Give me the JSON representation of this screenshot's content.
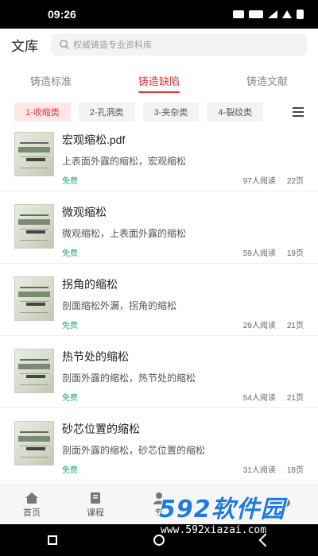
{
  "status": {
    "time": "09:26"
  },
  "header": {
    "title": "文库",
    "search_placeholder": "权威铸造专业资料库"
  },
  "tabs": [
    {
      "label": "铸造标准"
    },
    {
      "label": "铸造缺陷"
    },
    {
      "label": "铸造文献"
    }
  ],
  "chips": [
    {
      "label": "1-收缩类"
    },
    {
      "label": "2-孔洞类"
    },
    {
      "label": "3-夹杂类"
    },
    {
      "label": "4-裂纹类"
    }
  ],
  "items": [
    {
      "title": "宏观缩松.pdf",
      "desc": "上表面外露的缩松，宏观缩松",
      "price": "免费",
      "reads": "97人阅读",
      "pages": "22页"
    },
    {
      "title": "微观缩松",
      "desc": "微观缩松，上表面外露的缩松",
      "price": "免费",
      "reads": "59人阅读",
      "pages": "19页"
    },
    {
      "title": "拐角的缩松",
      "desc": "剖面缩松外漏，拐角的缩松",
      "price": "免费",
      "reads": "29人阅读",
      "pages": "21页"
    },
    {
      "title": "热节处的缩松",
      "desc": "剖面外露的缩松，热节处的缩松",
      "price": "免费",
      "reads": "54人阅读",
      "pages": "21页"
    },
    {
      "title": "砂芯位置的缩松",
      "desc": "剖面外露的缩松，砂芯位置的缩松",
      "price": "免费",
      "reads": "31人阅读",
      "pages": "18页"
    }
  ],
  "bottom_nav": [
    {
      "label": "首页",
      "icon": "home-icon"
    },
    {
      "label": "课程",
      "icon": "course-icon"
    },
    {
      "label": "专",
      "icon": "profile-icon"
    },
    {
      "label": "",
      "icon": "mail-icon"
    },
    {
      "label": "",
      "icon": "user-icon"
    }
  ],
  "watermark": {
    "brand": "592软件园",
    "url": "www.592xiazai.com"
  },
  "colors": {
    "accent": "#e2333b",
    "free": "#20b06a"
  }
}
